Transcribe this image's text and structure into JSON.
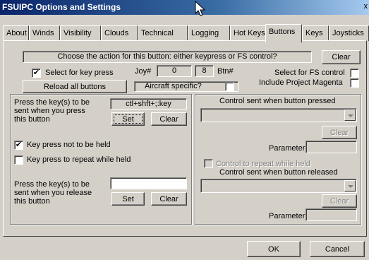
{
  "window": {
    "title": "FSUIPC Options and Settings",
    "close_glyph": "x"
  },
  "tabs": [
    "About",
    "Winds",
    "Visibility",
    "Clouds",
    "Technical",
    "Logging",
    "Hot Keys",
    "Buttons",
    "Keys",
    "Joysticks"
  ],
  "selected_tab": "Buttons",
  "top": {
    "prompt": "Choose the action for this button: either keypress or FS control?",
    "clear_label": "Clear",
    "select_key_label": "Select for key press",
    "select_key_checked": "✔",
    "joy_label": "Joy#",
    "joy_value": "0",
    "btn_value": "8",
    "btn_label": "Btn#",
    "select_fs_label": "Select for FS control",
    "include_pm_label": "Include Project Magenta",
    "reload_label": "Reload all buttons",
    "aircraft_label": "Aircraft specific?"
  },
  "left_group": {
    "press_label": "Press the key(s) to be sent when you press this button",
    "press_value": "ctl+shft+;:key",
    "set_label": "Set",
    "clear_label": "Clear",
    "not_held_label": "Key press not to be held",
    "not_held_checked": "✔",
    "repeat_label": "Key press to repeat while held",
    "release_label": "Press the key(s) to be sent when you release this button",
    "release_value": "",
    "set2_label": "Set",
    "clear2_label": "Clear"
  },
  "right_group": {
    "pressed_label": "Control sent when button pressed",
    "clear_label": "Clear",
    "parameter_label": "Parameter",
    "repeat_label": "Control to repeat while held",
    "released_label": "Control sent when button released",
    "clear2_label": "Clear",
    "parameter2_label": "Parameter"
  },
  "footer": {
    "ok_label": "OK",
    "cancel_label": "Cancel"
  }
}
